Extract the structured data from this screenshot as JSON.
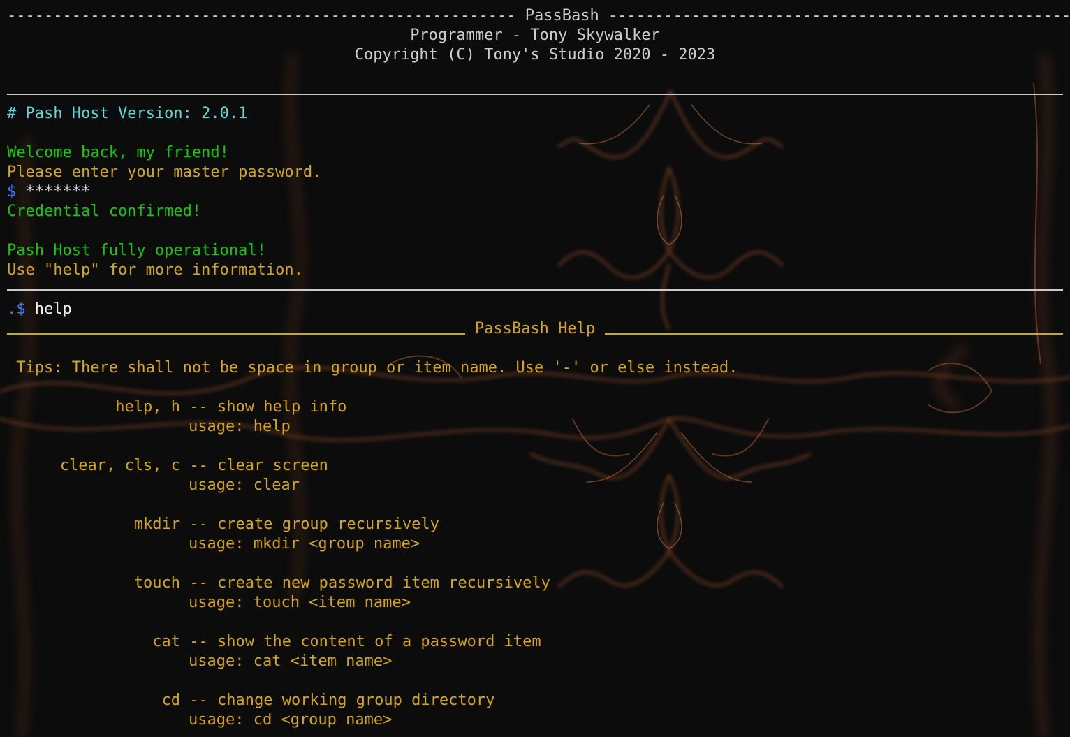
{
  "colors": {
    "background": "#0c0c0c",
    "gray": "#cccccc",
    "cyan": "#61d6d6",
    "green": "#16c60c",
    "yellow": "#d4a516",
    "blue": "#3b78ff",
    "smoke": "#a0522d"
  },
  "header": {
    "banner": "------------------------------------------------------- PassBash -------------------------------------------------------",
    "programmer": "Programmer - Tony Skywalker",
    "copyright": "Copyright (C) Tony's Studio 2020 - 2023"
  },
  "startup": {
    "version": "# Pash Host Version: 2.0.1",
    "welcome": "Welcome back, my friend!",
    "prompt_password": "Please enter your master password.",
    "password_prompt_symbol": "$",
    "password_masked": "*******",
    "confirmed": "Credential confirmed!",
    "operational": "Pash Host fully operational!",
    "hint": "Use \"help\" for more information."
  },
  "command_line": {
    "dot": ".",
    "prompt": "$",
    "input": "help"
  },
  "help": {
    "title": "PassBash Help",
    "tips": " Tips: There shall not be space in group or item name. Use '-' or else instead.",
    "commands": [
      {
        "names": "help, h",
        "desc": "show help info",
        "usage": "usage: help"
      },
      {
        "names": "clear, cls, c",
        "desc": "clear screen",
        "usage": "usage: clear"
      },
      {
        "names": "mkdir",
        "desc": "create group recursively",
        "usage": "usage: mkdir <group name>"
      },
      {
        "names": "touch",
        "desc": "create new password item recursively",
        "usage": "usage: touch <item name>"
      },
      {
        "names": "cat",
        "desc": "show the content of a password item",
        "usage": "usage: cat <item name>"
      },
      {
        "names": "cd",
        "desc": "change working group directory",
        "usage": "usage: cd <group name>"
      }
    ]
  }
}
